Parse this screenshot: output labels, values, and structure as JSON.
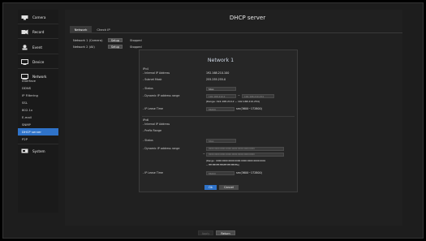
{
  "sidebar": {
    "menu": [
      {
        "label": "Camera",
        "icon": "camera-icon"
      },
      {
        "label": "Record",
        "icon": "record-icon"
      },
      {
        "label": "Event",
        "icon": "event-icon"
      },
      {
        "label": "Device",
        "icon": "device-icon"
      },
      {
        "label": "Network",
        "icon": "network-icon"
      },
      {
        "label": "System",
        "icon": "system-icon"
      }
    ],
    "network_subitems": [
      "Interface",
      "DDNS",
      "IP Filtering",
      "SSL",
      "802.1x",
      "E-mail",
      "SNMP",
      "DHCP server",
      "P2P"
    ],
    "active_subitem": "DHCP server"
  },
  "page": {
    "title": "DHCP server",
    "tabs": [
      "Network",
      "Check IP"
    ],
    "rows": [
      {
        "name": "Network 1 (Camera)",
        "button": "Setup",
        "status": "Stopped"
      },
      {
        "name": "Network 2 (All)",
        "button": "Setup",
        "status": "Stopped"
      }
    ]
  },
  "dialog": {
    "title": "Network 1",
    "ipv4": {
      "section": "IPv4",
      "internal_ip_label": "- Internal IP Address",
      "internal_ip": "192.168.210.100",
      "subnet_label": "- Subnet Mask",
      "subnet": "255.255.255.0",
      "status_label": "- Status",
      "status_value": "Stop",
      "dynamic_label": "- Dynamic IP address range",
      "range_start": "192.168.210.2",
      "range_end": "192.168.210.254",
      "range_note": "(Range: 192.168.210.2 ~ 192.168.210.254)",
      "lease_label": "- IP Lease Time",
      "lease_value": "86400",
      "lease_unit": "sec(3600~172800)"
    },
    "ipv6": {
      "section": "IPv6",
      "internal_ip_label": "- Internal IP Address",
      "prefix_label": "- Prefix Range",
      "status_label": "- Status",
      "status_value": "Stop",
      "dynamic_label": "- Dynamic IP address range",
      "range_start": "0000:0000:0000:0000:0000:0000:0000:0000",
      "range_end": "0000:0000:0000:0000:0000:0000:0000:0000",
      "range_note_1": "(Range : 0000:0000:0000:0000:0000:0000:0000:0001",
      "range_note_2": "~ ffff:ffff:ffff:ffff:ffff:ffff:ffff:fffe)",
      "lease_label": "- IP Lease Time",
      "lease_value": "86400",
      "lease_unit": "sec(3600~172800)"
    },
    "ok": "Ok",
    "cancel": "Cancel"
  },
  "footer": {
    "apply": "Apply",
    "return": "Return"
  },
  "colors": {
    "accent": "#2f73c9",
    "background": "#1d1d1d"
  }
}
